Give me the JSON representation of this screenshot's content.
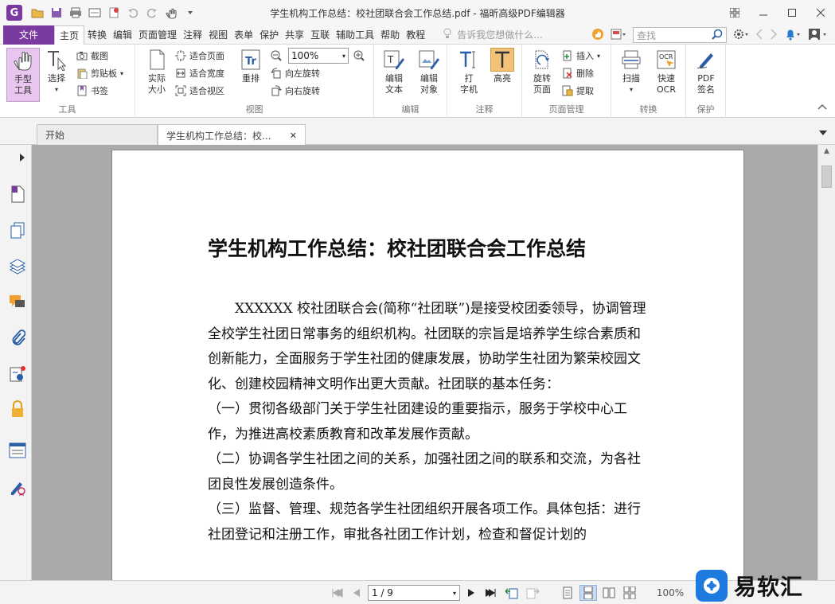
{
  "window": {
    "title": "学生机构工作总结：校社团联合会工作总结.pdf - 福昕高级PDF编辑器",
    "app_logo": "G"
  },
  "menu": {
    "file": "文件",
    "tabs": [
      "主页",
      "转换",
      "编辑",
      "页面管理",
      "注释",
      "视图",
      "表单",
      "保护",
      "共享",
      "互联",
      "辅助工具",
      "帮助",
      "教程"
    ],
    "tell_me": "告诉我您想做什么...",
    "search_placeholder": "查找"
  },
  "ribbon": {
    "tools": {
      "label": "工具",
      "hand": "手型\n工具",
      "select": "选择",
      "screenshot": "截图",
      "clipboard": "剪贴板",
      "bookmark": "书签"
    },
    "view": {
      "label": "视图",
      "actual_size": "实际\n大小",
      "fit_page": "适合页面",
      "fit_width": "适合宽度",
      "fit_visible": "适合视区",
      "reflow": "重排",
      "zoom": "100%",
      "rotate_left": "向左旋转",
      "rotate_right": "向右旋转"
    },
    "edit": {
      "label": "编辑",
      "edit_text": "编辑\n文本",
      "edit_object": "编辑\n对象"
    },
    "annotate": {
      "label": "注释",
      "typewriter": "打\n字机",
      "highlight": "高亮"
    },
    "page_manage": {
      "label": "页面管理",
      "rotate_page": "旋转\n页面",
      "insert": "插入",
      "delete": "删除",
      "extract": "提取"
    },
    "convert": {
      "label": "转换",
      "scan": "扫描",
      "quick_ocr": "快速\nOCR"
    },
    "protect": {
      "label": "保护",
      "pdf_sign": "PDF\n签名"
    }
  },
  "doc_tabs": [
    {
      "label": "开始"
    },
    {
      "label": "学生机构工作总结：校...",
      "close": "✕"
    }
  ],
  "document": {
    "title": "学生机构工作总结：校社团联合会工作总结",
    "paragraphs": [
      "XXXXXX 校社团联合会(简称“社团联”)是接受校团委领导，协调管理全校学生社团日常事务的组织机构。社团联的宗旨是培养学生综合素质和创新能力，全面服务于学生社团的健康发展，协助学生社团为繁荣校园文化、创建校园精神文明作出更大贡献。社团联的基本任务：",
      "（一）贯彻各级部门关于学生社团建设的重要指示，服务于学校中心工作，为推进高校素质教育和改革发展作贡献。",
      "（二）协调各学生社团之间的关系，加强社团之间的联系和交流，为各社团良性发展创造条件。",
      "（三）监督、管理、规范各学生社团组织开展各项工作。具体包括：进行社团登记和注册工作，审批各社团工作计划，检查和督促计划的"
    ]
  },
  "statusbar": {
    "page": "1 / 9",
    "zoom": "100%"
  },
  "watermark": {
    "text": "易软汇"
  },
  "colors": {
    "accent": "#7b3aa0",
    "hand_tool_bg": "#e8c6ef",
    "highlight_bg": "#f3c27a",
    "doc_background": "#a9a9a9"
  }
}
